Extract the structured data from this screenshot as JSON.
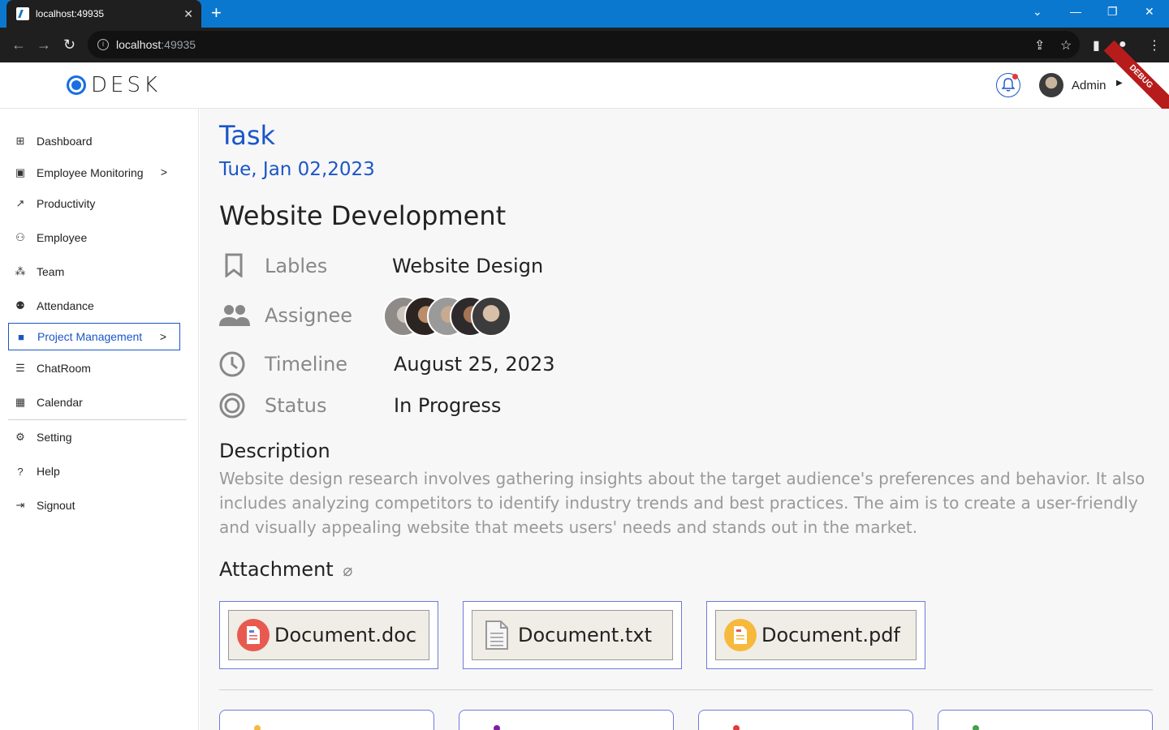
{
  "browser": {
    "tab_title": "localhost:49935",
    "url_host": "localhost",
    "url_port": ":49935"
  },
  "header": {
    "logo_text": "DESK",
    "user_name": "Admin",
    "debug_label": "DEBUG"
  },
  "sidebar": {
    "items": [
      {
        "label": "Dashboard",
        "icon": "dashboard-icon"
      },
      {
        "label": "Employee Monitoring",
        "icon": "monitor-icon"
      },
      {
        "label": "Productivity",
        "icon": "chart-icon"
      },
      {
        "label": "Employee",
        "icon": "person-icon"
      },
      {
        "label": "Team",
        "icon": "team-icon"
      },
      {
        "label": "Attendance",
        "icon": "attendance-icon"
      },
      {
        "label": "Project Management",
        "icon": "folder-icon"
      },
      {
        "label": "ChatRoom",
        "icon": "chat-icon"
      },
      {
        "label": "Calendar",
        "icon": "calendar-icon"
      },
      {
        "label": "Setting",
        "icon": "gear-icon"
      },
      {
        "label": "Help",
        "icon": "help-icon"
      },
      {
        "label": "Signout",
        "icon": "signout-icon"
      }
    ]
  },
  "main": {
    "page_title": "Task",
    "date": "Tue, Jan 02,2023",
    "task_title": "Website Development",
    "labels_label": "Lables",
    "labels_value": "Website Design",
    "assignee_label": "Assignee",
    "timeline_label": "Timeline",
    "timeline_value": "August 25, 2023",
    "status_label": "Status",
    "status_value": "In Progress",
    "description_title": "Description",
    "description": "Website design research involves gathering insights about the target audience's preferences and behavior. It also includes analyzing competitors to identify industry trends and best practices. The aim is to create a user-friendly and visually appealing website that meets users' needs and stands out in the market.",
    "attachment_title": "Attachment",
    "attachments": [
      {
        "name": "Document.doc",
        "color": "#e85a4f"
      },
      {
        "name": "Document.txt",
        "color": "#999999"
      },
      {
        "name": "Document.pdf",
        "color": "#f6b93b"
      }
    ]
  },
  "colors": {
    "accent": "#1a56c8",
    "browser_bar": "#0b78d0"
  }
}
